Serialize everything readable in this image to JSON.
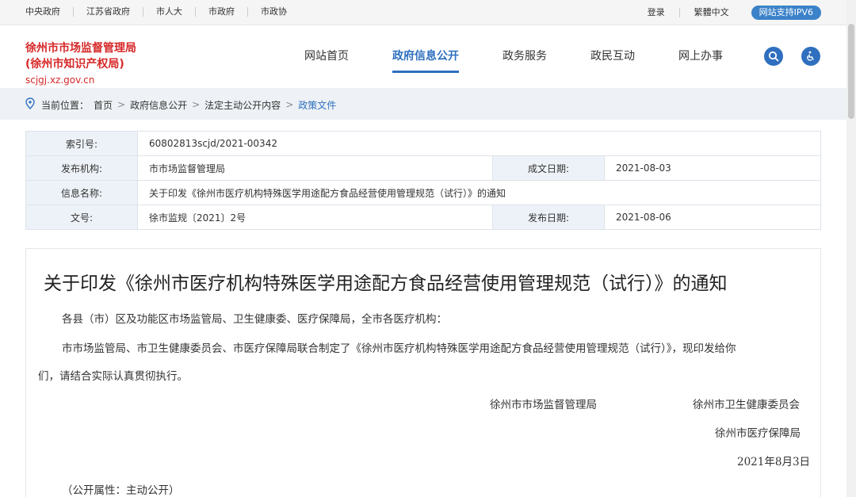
{
  "topbar": {
    "links": [
      "中央政府",
      "江苏省政府",
      "市人大",
      "市政府",
      "市政协"
    ],
    "login": "登录",
    "traditional": "繁體中文",
    "ipv6": "网站支持IPV6"
  },
  "header": {
    "org_line1": "徐州市市场监督管理局",
    "org_line2": "(徐州市知识产权局)",
    "domain": "scjgj.xz.gov.cn",
    "nav": [
      "网站首页",
      "政府信息公开",
      "政务服务",
      "政民互动",
      "网上办事"
    ],
    "search_icon": "search-icon",
    "accessibility_icon": "accessibility-icon"
  },
  "breadcrumb": {
    "prefix": "当前位置：",
    "items": [
      "首页",
      "政府信息公开",
      "法定主动公开内容"
    ],
    "current": "政策文件"
  },
  "info": {
    "index_label": "索引号:",
    "index_value": "60802813scjd/2021-00342",
    "publisher_label": "发布机构:",
    "publisher_value": "市市场监督管理局",
    "written_date_label": "成文日期:",
    "written_date_value": "2021-08-03",
    "name_label": "信息名称:",
    "name_value": "关于印发《徐州市医疗机构特殊医学用途配方食品经营使用管理规范（试行）》的通知",
    "doc_no_label": "文号:",
    "doc_no_value": "徐市监规〔2021〕2号",
    "pub_date_label": "发布日期:",
    "pub_date_value": "2021-08-06"
  },
  "article": {
    "title": "关于印发《徐州市医疗机构特殊医学用途配方食品经营使用管理规范（试行）》的通知",
    "addressee": "各县（市）区及功能区市场监管局、卫生健康委、医疗保障局，全市各医疗机构：",
    "body_line1": "市市场监管局、市卫生健康委员会、市医疗保障局联合制定了《徐州市医疗机构特殊医学用途配方食品经营使用管理规范（试行）》，现印发给你",
    "body_line2": "们，请结合实际认真贯彻执行。",
    "signer1": "徐州市市场监督管理局",
    "signer2": "徐州市卫生健康委员会",
    "signer3": "徐州市医疗保障局",
    "date": "2021年8月3日",
    "disclosure": "（公开属性：主动公开）"
  },
  "colors": {
    "brand_red": "#d62828",
    "accent_blue": "#2f6fbf"
  }
}
